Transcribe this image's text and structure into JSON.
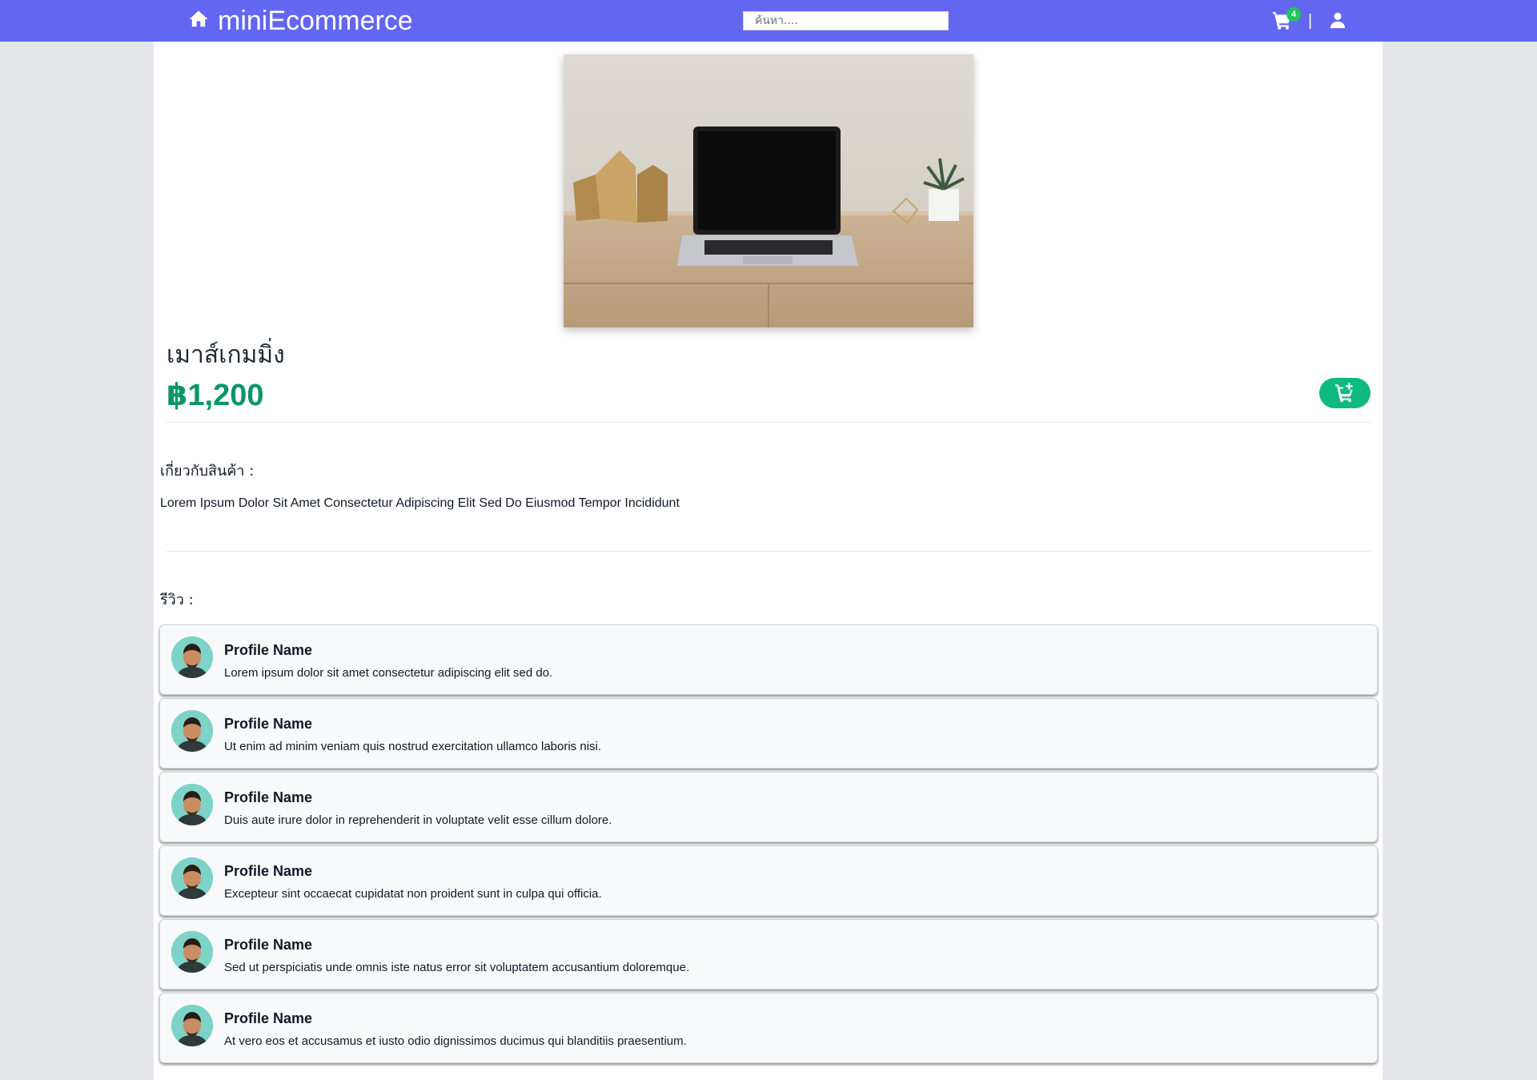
{
  "nav": {
    "brand": "miniEcommerce",
    "search_placeholder": "ค้นหา....",
    "cart_count": "4",
    "separator": "|"
  },
  "product": {
    "name": "เมาส์เกมมิ่ง",
    "price": "฿1,200",
    "image_alt": "laptop-on-desk"
  },
  "about": {
    "label": "เกี่ยวกับสินค้า :",
    "text": "Lorem Ipsum Dolor Sit Amet Consectetur Adipiscing Elit Sed Do Eiusmod Tempor Incididunt"
  },
  "reviews": {
    "label": "รีวิว :",
    "items": [
      {
        "name": "Profile Name",
        "text": "Lorem ipsum dolor sit amet consectetur adipiscing elit sed do."
      },
      {
        "name": "Profile Name",
        "text": "Ut enim ad minim veniam quis nostrud exercitation ullamco laboris nisi."
      },
      {
        "name": "Profile Name",
        "text": "Duis aute irure dolor in reprehenderit in voluptate velit esse cillum dolore."
      },
      {
        "name": "Profile Name",
        "text": "Excepteur sint occaecat cupidatat non proident sunt in culpa qui officia."
      },
      {
        "name": "Profile Name",
        "text": "Sed ut perspiciatis unde omnis iste natus error sit voluptatem accusantium doloremque."
      },
      {
        "name": "Profile Name",
        "text": "At vero eos et accusamus et iusto odio dignissimos ducimus qui blanditiis praesentium."
      }
    ]
  },
  "colors": {
    "navbar": "#6366f1",
    "price": "#059669",
    "add_button": "#10b981",
    "badge": "#22c55e"
  },
  "icons": [
    "home-icon",
    "cart-icon",
    "user-icon",
    "add-to-cart-icon"
  ]
}
